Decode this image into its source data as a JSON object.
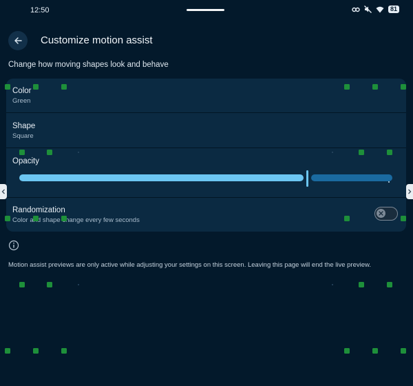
{
  "status_bar": {
    "time": "12:50",
    "battery": "81"
  },
  "header": {
    "title": "Customize motion assist"
  },
  "subtitle": "Change how moving shapes look and behave",
  "settings": {
    "color": {
      "title": "Color",
      "value": "Green"
    },
    "shape": {
      "title": "Shape",
      "value": "Square"
    },
    "opacity": {
      "title": "Opacity",
      "value_fraction": 0.77
    },
    "randomization": {
      "title": "Randomization",
      "description": "Color and shape change every few seconds",
      "enabled": false
    }
  },
  "footnote": "Motion assist previews are only active while adjusting your settings on this screen. Leaving this page will end the live preview.",
  "icons": [
    "arrow-back-icon",
    "info-icon",
    "link-icon",
    "mute-icon",
    "wifi-icon",
    "close-icon",
    "chevron-left-icon",
    "chevron-right-icon"
  ],
  "colors": {
    "background": "#03192b",
    "card": "#0b2a42",
    "accent": "#6cc6f2",
    "motion_shape": "#1e8f3a"
  }
}
